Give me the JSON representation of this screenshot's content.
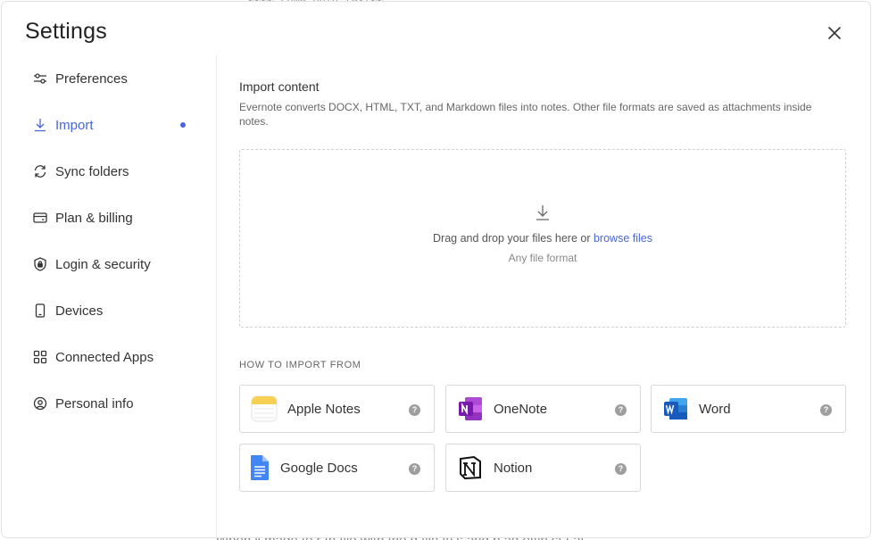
{
  "background": {
    "top_text": "~~~~ some bold text~~",
    "bottom_text": "When ll  made   to r   th file   with  the    d file   ty  s    and  b     ad  ettin   st  t   at"
  },
  "modal": {
    "title": "Settings",
    "close_icon": "close-icon"
  },
  "sidebar": {
    "items": [
      {
        "label": "Preferences",
        "icon": "sliders-icon",
        "active": false
      },
      {
        "label": "Import",
        "icon": "download-icon",
        "active": true
      },
      {
        "label": "Sync folders",
        "icon": "sync-icon",
        "active": false
      },
      {
        "label": "Plan & billing",
        "icon": "credit-card-icon",
        "active": false
      },
      {
        "label": "Login & security",
        "icon": "shield-icon",
        "active": false
      },
      {
        "label": "Devices",
        "icon": "phone-icon",
        "active": false
      },
      {
        "label": "Connected Apps",
        "icon": "grid-icon",
        "active": false
      },
      {
        "label": "Personal info",
        "icon": "at-icon",
        "active": false
      }
    ]
  },
  "import": {
    "title": "Import content",
    "description": "Evernote converts DOCX, HTML, TXT, and Markdown files into notes. Other file formats are saved as attachments inside notes.",
    "dropzone": {
      "text": "Drag and drop your files here or",
      "link": "browse files",
      "subtext": "Any file format"
    },
    "how_title": "HOW TO IMPORT FROM",
    "sources": [
      {
        "label": "Apple Notes",
        "icon": "apple-notes-icon"
      },
      {
        "label": "OneNote",
        "icon": "onenote-icon"
      },
      {
        "label": "Word",
        "icon": "word-icon"
      },
      {
        "label": "Google Docs",
        "icon": "google-docs-icon"
      },
      {
        "label": "Notion",
        "icon": "notion-icon"
      }
    ],
    "help_glyph": "?"
  },
  "colors": {
    "accent": "#4866d8",
    "onenote": "#7719aa",
    "word": "#185abd",
    "google_docs": "#4285f4",
    "apple_notes": "#f7d154"
  }
}
